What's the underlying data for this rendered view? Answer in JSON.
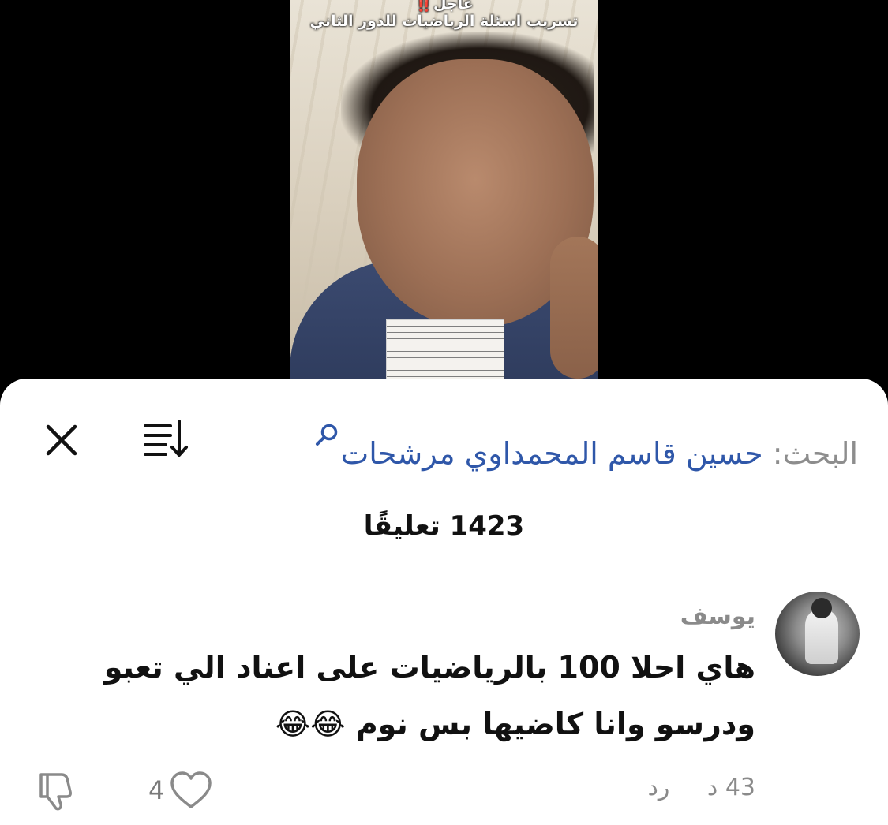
{
  "video": {
    "caption_line1": "عاجل",
    "caption_warning": "‼️",
    "caption_line2": "تسريب اسئلة الرياضيات للدور الثاني"
  },
  "header": {
    "search_label": "البحث: ",
    "search_query": "حسين قاسم المحمداوي مرشحات"
  },
  "comments_count": "1423 تعليقًا",
  "comment": {
    "username": "يوسف",
    "text_line1": "هاي احلا 100 بالرياضيات على اعناد الي تعبو",
    "text_line2": "ودرسو وانا كاضيها بس نوم 😂😂",
    "time": "43 د",
    "reply_label": "رد",
    "likes": "4"
  },
  "icons": {
    "close": "close-icon",
    "sort": "sort-icon",
    "search": "search-icon",
    "heart": "heart-icon",
    "dislike": "thumbs-down-icon"
  },
  "colors": {
    "accent": "#2f57a9",
    "muted": "#8a8a8a",
    "warning": "#e02525"
  }
}
